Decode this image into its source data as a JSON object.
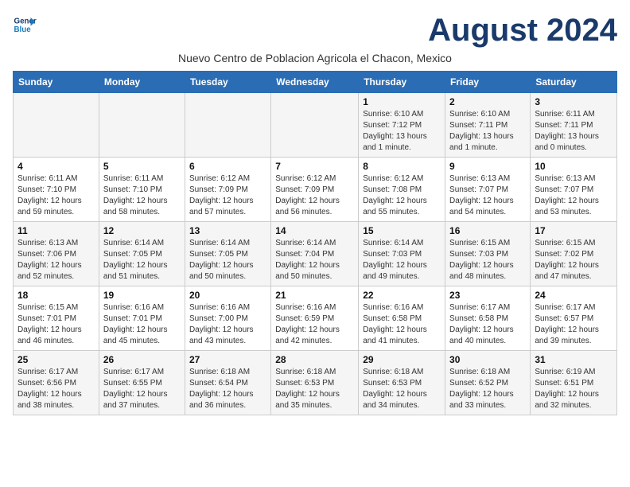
{
  "header": {
    "logo_line1": "General",
    "logo_line2": "Blue",
    "month_title": "August 2024",
    "subtitle": "Nuevo Centro de Poblacion Agricola el Chacon, Mexico"
  },
  "days_of_week": [
    "Sunday",
    "Monday",
    "Tuesday",
    "Wednesday",
    "Thursday",
    "Friday",
    "Saturday"
  ],
  "weeks": [
    [
      {
        "day": "",
        "info": ""
      },
      {
        "day": "",
        "info": ""
      },
      {
        "day": "",
        "info": ""
      },
      {
        "day": "",
        "info": ""
      },
      {
        "day": "1",
        "info": "Sunrise: 6:10 AM\nSunset: 7:12 PM\nDaylight: 13 hours\nand 1 minute."
      },
      {
        "day": "2",
        "info": "Sunrise: 6:10 AM\nSunset: 7:11 PM\nDaylight: 13 hours\nand 1 minute."
      },
      {
        "day": "3",
        "info": "Sunrise: 6:11 AM\nSunset: 7:11 PM\nDaylight: 13 hours\nand 0 minutes."
      }
    ],
    [
      {
        "day": "4",
        "info": "Sunrise: 6:11 AM\nSunset: 7:10 PM\nDaylight: 12 hours\nand 59 minutes."
      },
      {
        "day": "5",
        "info": "Sunrise: 6:11 AM\nSunset: 7:10 PM\nDaylight: 12 hours\nand 58 minutes."
      },
      {
        "day": "6",
        "info": "Sunrise: 6:12 AM\nSunset: 7:09 PM\nDaylight: 12 hours\nand 57 minutes."
      },
      {
        "day": "7",
        "info": "Sunrise: 6:12 AM\nSunset: 7:09 PM\nDaylight: 12 hours\nand 56 minutes."
      },
      {
        "day": "8",
        "info": "Sunrise: 6:12 AM\nSunset: 7:08 PM\nDaylight: 12 hours\nand 55 minutes."
      },
      {
        "day": "9",
        "info": "Sunrise: 6:13 AM\nSunset: 7:07 PM\nDaylight: 12 hours\nand 54 minutes."
      },
      {
        "day": "10",
        "info": "Sunrise: 6:13 AM\nSunset: 7:07 PM\nDaylight: 12 hours\nand 53 minutes."
      }
    ],
    [
      {
        "day": "11",
        "info": "Sunrise: 6:13 AM\nSunset: 7:06 PM\nDaylight: 12 hours\nand 52 minutes."
      },
      {
        "day": "12",
        "info": "Sunrise: 6:14 AM\nSunset: 7:05 PM\nDaylight: 12 hours\nand 51 minutes."
      },
      {
        "day": "13",
        "info": "Sunrise: 6:14 AM\nSunset: 7:05 PM\nDaylight: 12 hours\nand 50 minutes."
      },
      {
        "day": "14",
        "info": "Sunrise: 6:14 AM\nSunset: 7:04 PM\nDaylight: 12 hours\nand 50 minutes."
      },
      {
        "day": "15",
        "info": "Sunrise: 6:14 AM\nSunset: 7:03 PM\nDaylight: 12 hours\nand 49 minutes."
      },
      {
        "day": "16",
        "info": "Sunrise: 6:15 AM\nSunset: 7:03 PM\nDaylight: 12 hours\nand 48 minutes."
      },
      {
        "day": "17",
        "info": "Sunrise: 6:15 AM\nSunset: 7:02 PM\nDaylight: 12 hours\nand 47 minutes."
      }
    ],
    [
      {
        "day": "18",
        "info": "Sunrise: 6:15 AM\nSunset: 7:01 PM\nDaylight: 12 hours\nand 46 minutes."
      },
      {
        "day": "19",
        "info": "Sunrise: 6:16 AM\nSunset: 7:01 PM\nDaylight: 12 hours\nand 45 minutes."
      },
      {
        "day": "20",
        "info": "Sunrise: 6:16 AM\nSunset: 7:00 PM\nDaylight: 12 hours\nand 43 minutes."
      },
      {
        "day": "21",
        "info": "Sunrise: 6:16 AM\nSunset: 6:59 PM\nDaylight: 12 hours\nand 42 minutes."
      },
      {
        "day": "22",
        "info": "Sunrise: 6:16 AM\nSunset: 6:58 PM\nDaylight: 12 hours\nand 41 minutes."
      },
      {
        "day": "23",
        "info": "Sunrise: 6:17 AM\nSunset: 6:58 PM\nDaylight: 12 hours\nand 40 minutes."
      },
      {
        "day": "24",
        "info": "Sunrise: 6:17 AM\nSunset: 6:57 PM\nDaylight: 12 hours\nand 39 minutes."
      }
    ],
    [
      {
        "day": "25",
        "info": "Sunrise: 6:17 AM\nSunset: 6:56 PM\nDaylight: 12 hours\nand 38 minutes."
      },
      {
        "day": "26",
        "info": "Sunrise: 6:17 AM\nSunset: 6:55 PM\nDaylight: 12 hours\nand 37 minutes."
      },
      {
        "day": "27",
        "info": "Sunrise: 6:18 AM\nSunset: 6:54 PM\nDaylight: 12 hours\nand 36 minutes."
      },
      {
        "day": "28",
        "info": "Sunrise: 6:18 AM\nSunset: 6:53 PM\nDaylight: 12 hours\nand 35 minutes."
      },
      {
        "day": "29",
        "info": "Sunrise: 6:18 AM\nSunset: 6:53 PM\nDaylight: 12 hours\nand 34 minutes."
      },
      {
        "day": "30",
        "info": "Sunrise: 6:18 AM\nSunset: 6:52 PM\nDaylight: 12 hours\nand 33 minutes."
      },
      {
        "day": "31",
        "info": "Sunrise: 6:19 AM\nSunset: 6:51 PM\nDaylight: 12 hours\nand 32 minutes."
      }
    ]
  ]
}
